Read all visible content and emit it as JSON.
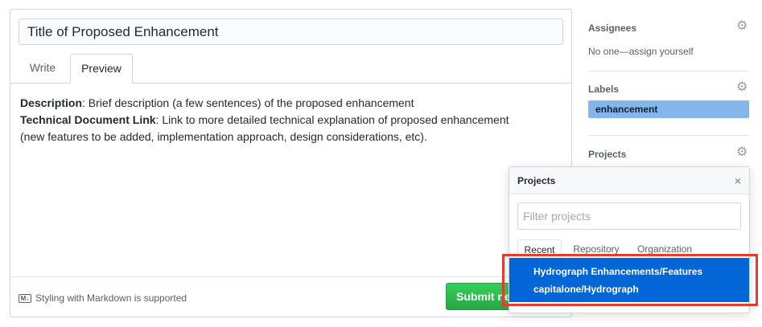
{
  "issue": {
    "title_value": "Title of Proposed Enhancement",
    "tabs": [
      {
        "label": "Write"
      },
      {
        "label": "Preview"
      }
    ],
    "preview": {
      "line1_bold": "Description",
      "line1_rest": ": Brief description (a few sentences) of the proposed enhancement",
      "line2_bold": "Technical Document Link",
      "line2_rest": ": Link to more detailed technical explanation of proposed enhancement",
      "line3": "(new features to be added, implementation approach, design considerations, etc)."
    },
    "markdown_note": "Styling with Markdown is supported",
    "markdown_icon_text": "M↓",
    "submit_label": "Submit new issue"
  },
  "sidebar": {
    "assignees": {
      "heading": "Assignees",
      "value": "No one—assign yourself"
    },
    "labels": {
      "heading": "Labels",
      "items": [
        {
          "name": "enhancement",
          "color": "#84b6eb"
        }
      ]
    },
    "projects": {
      "heading": "Projects"
    }
  },
  "projects_popup": {
    "title": "Projects",
    "close_icon": "×",
    "filter_placeholder": "Filter projects",
    "tabs": [
      {
        "label": "Recent"
      },
      {
        "label": "Repository"
      },
      {
        "label": "Organization"
      }
    ],
    "selected_item": {
      "name": "Hydrograph Enhancements/Features",
      "repo": "capitalone/Hydrograph"
    }
  },
  "icons": {
    "gear": "⚙"
  },
  "colors": {
    "accent_blue": "#0366d6",
    "submit_green": "#28a745",
    "highlight_red": "#e03e2f",
    "label_blue": "#84b6eb"
  }
}
